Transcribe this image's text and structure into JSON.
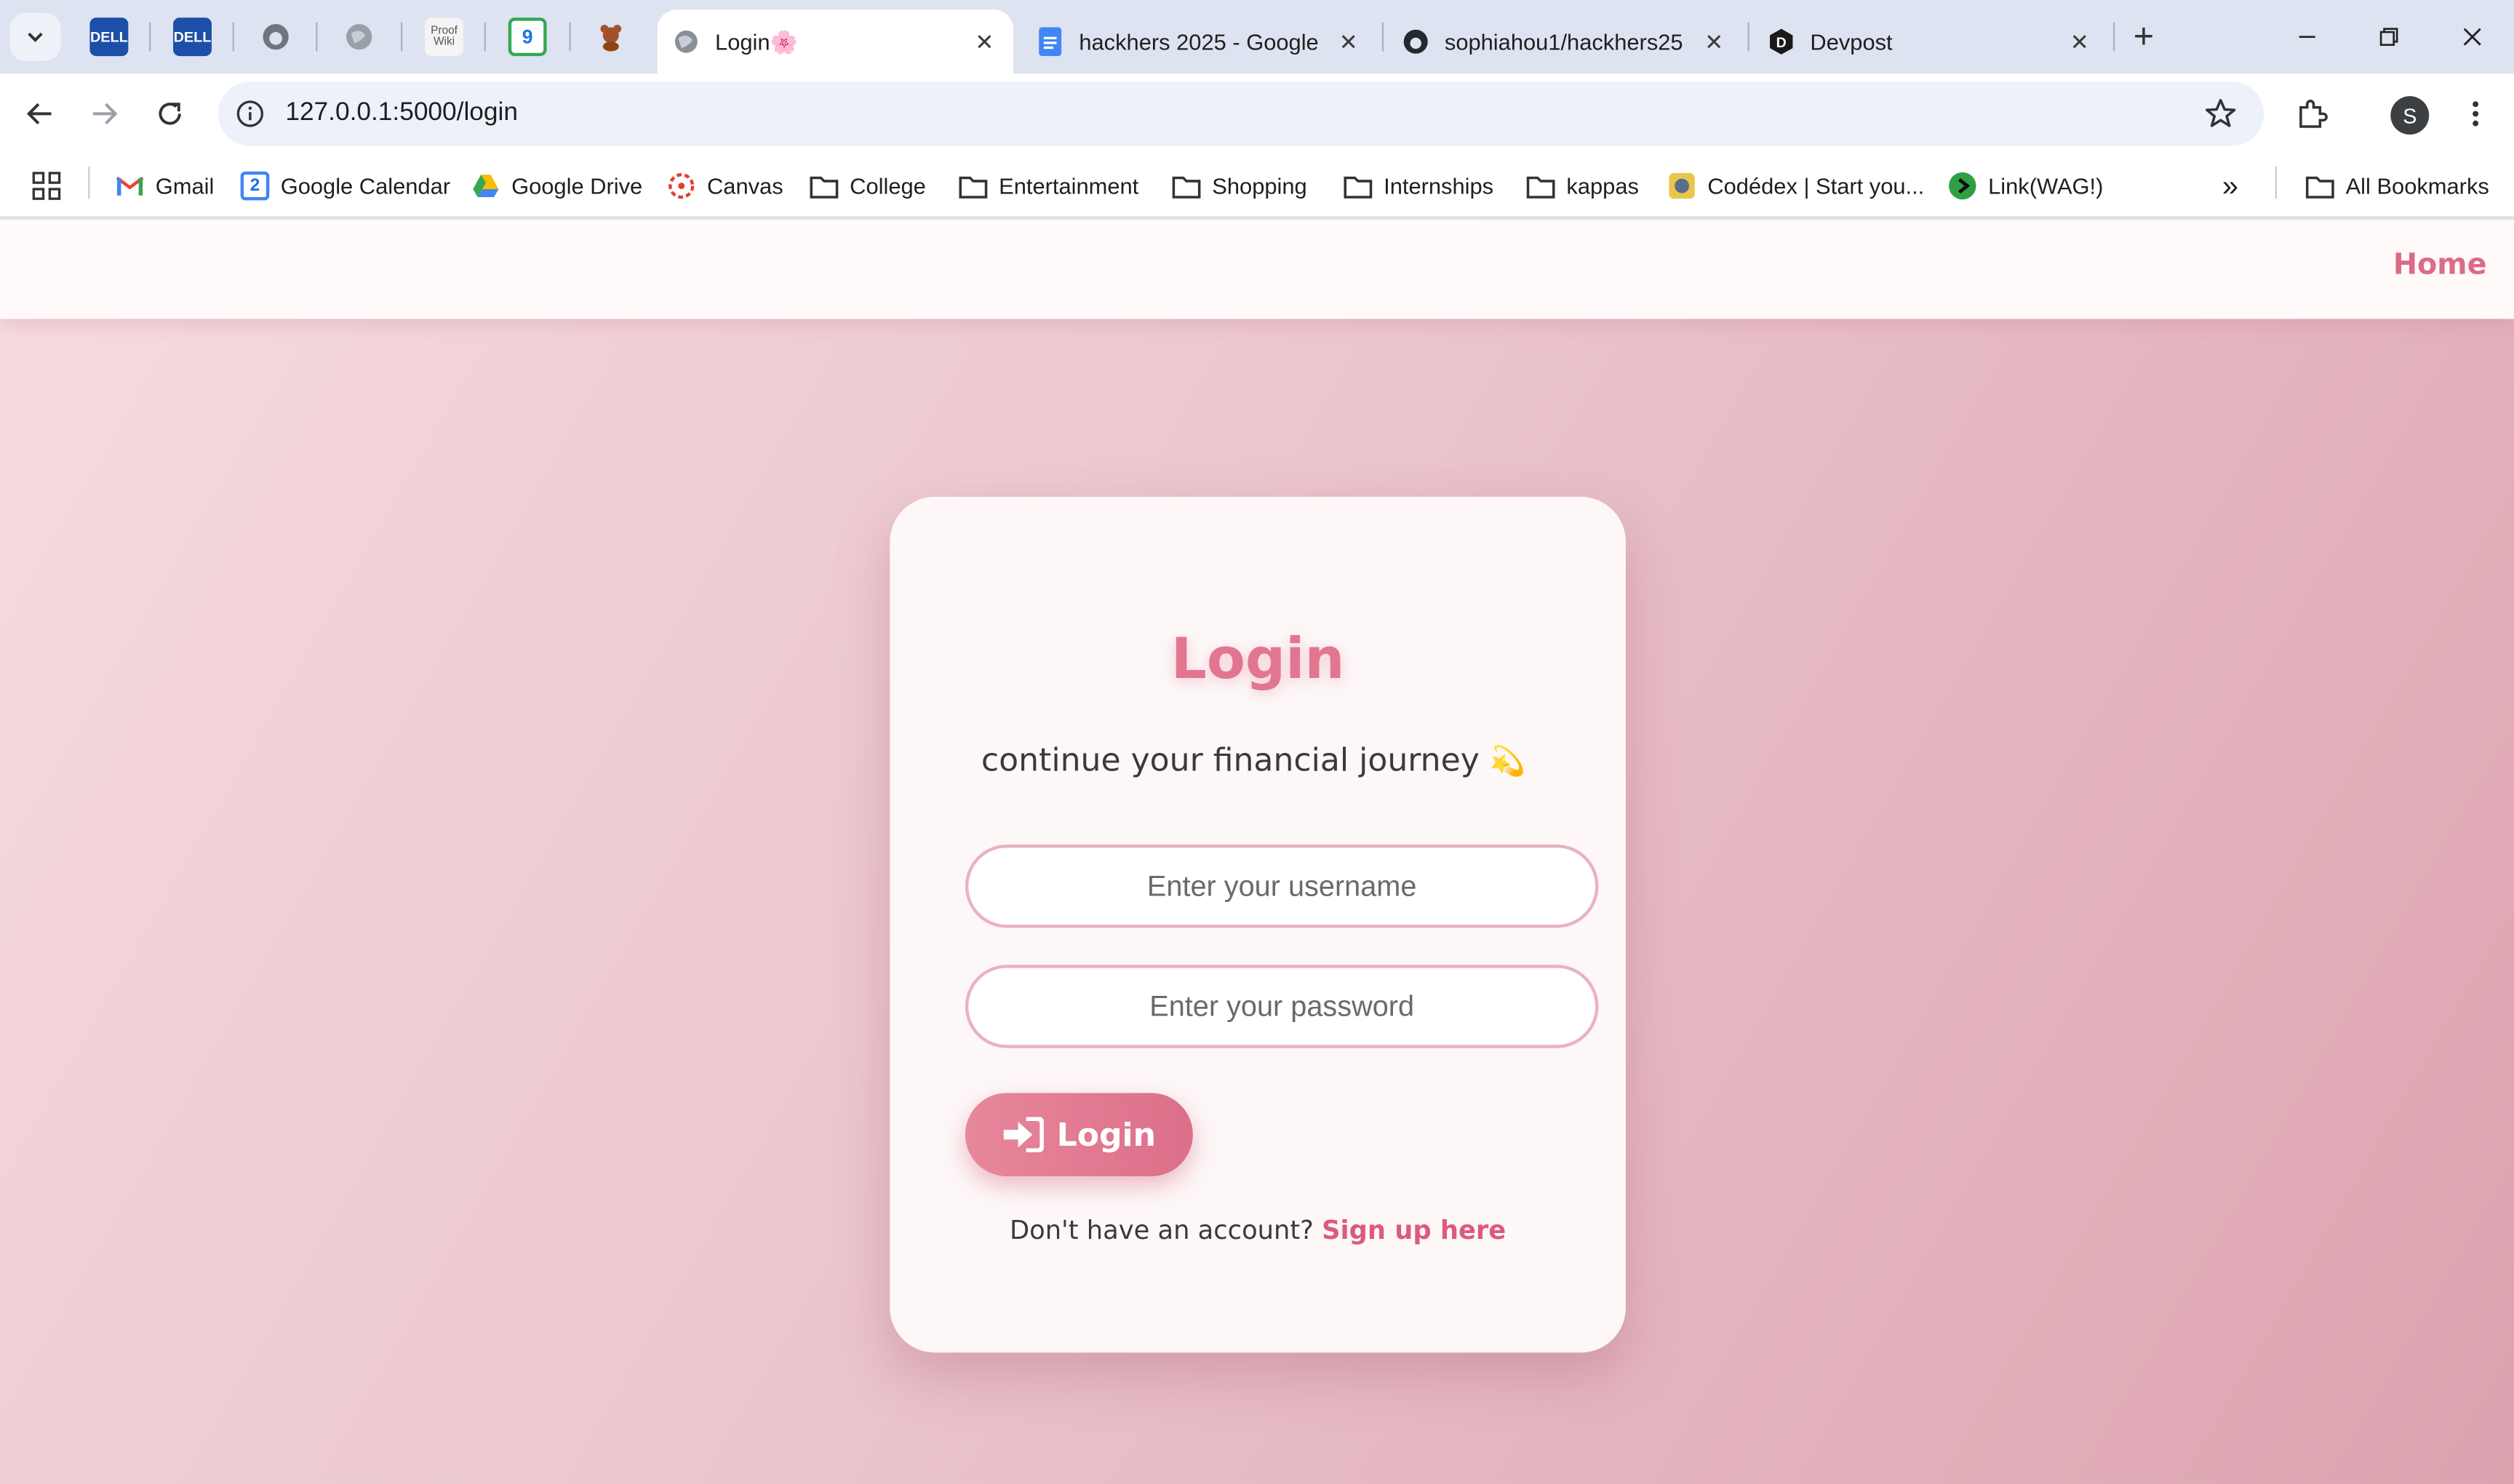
{
  "browser": {
    "tabs": [
      {
        "title": "Login🌸",
        "favicon": "globe-icon",
        "active": true
      },
      {
        "title": "hackhers 2025 - Google",
        "favicon": "google-docs-icon",
        "active": false
      },
      {
        "title": "sophiahou1/hackhers25",
        "favicon": "github-icon",
        "active": false
      },
      {
        "title": "Devpost",
        "favicon": "devpost-icon",
        "active": false
      }
    ],
    "pinned_tabs": [
      "dell-icon",
      "dell-icon",
      "github-icon",
      "globe-icon",
      "proofwiki-icon",
      "calendar-icon",
      "teddy-bear-icon"
    ],
    "pinned_labels": {
      "dell": "DELL",
      "proofwiki": "Proof Wiki",
      "calendar": "9"
    },
    "url": "127.0.0.1:5000/login",
    "profile_initial": "S",
    "bookmarks": [
      {
        "label": "Gmail",
        "icon": "gmail-icon"
      },
      {
        "label": "Google Calendar",
        "icon": "calendar-icon"
      },
      {
        "label": "Google Drive",
        "icon": "drive-icon"
      },
      {
        "label": "Canvas",
        "icon": "canvas-icon"
      },
      {
        "label": "College",
        "icon": "folder-icon"
      },
      {
        "label": "Entertainment",
        "icon": "folder-icon"
      },
      {
        "label": "Shopping",
        "icon": "folder-icon"
      },
      {
        "label": "Internships",
        "icon": "folder-icon"
      },
      {
        "label": "kappas",
        "icon": "folder-icon"
      },
      {
        "label": "Codédex | Start you...",
        "icon": "codedex-icon"
      },
      {
        "label": "Link(WAG!)",
        "icon": "link-icon"
      }
    ],
    "calendar_badge": "2",
    "all_bookmarks": "All Bookmarks",
    "overflow": "»"
  },
  "site": {
    "nav": {
      "home": "Home"
    },
    "login": {
      "title": "Login",
      "subtitle": "continue your financial journey",
      "subtitle_emoji": "💫",
      "username_placeholder": "Enter your username",
      "password_placeholder": "Enter your password",
      "button": "Login",
      "signup_prompt": "Don't have an account?",
      "signup_link": "Sign up here"
    }
  },
  "colors": {
    "accent": "#dc6b87",
    "title": "#e27690",
    "input_border": "#ebb1c1",
    "page_gradient_start": "#f5dbe0",
    "page_gradient_end": "#dca3af"
  }
}
